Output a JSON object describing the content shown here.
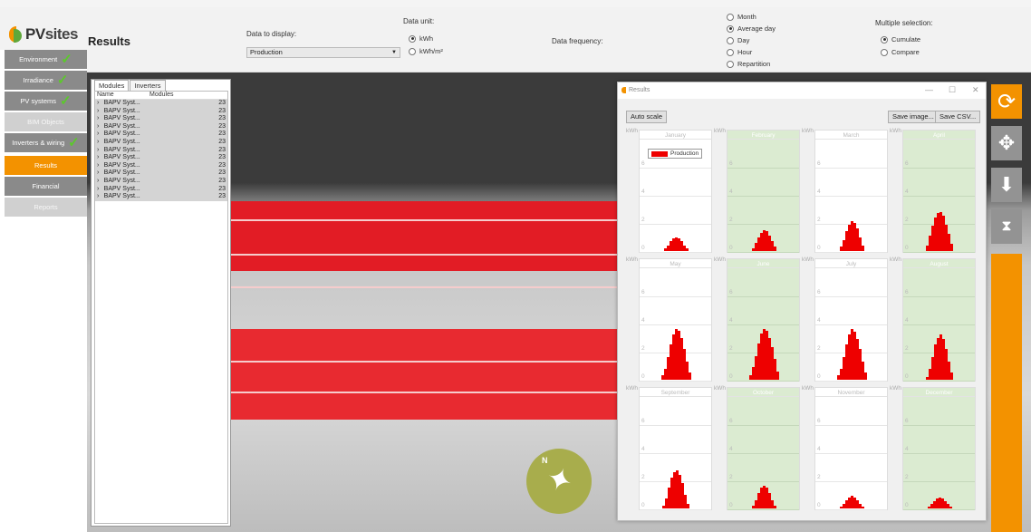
{
  "app": {
    "logo_text": "PVsites",
    "logo_pv": "PV",
    "logo_sites": "sites"
  },
  "page": {
    "title": "Results"
  },
  "controls": {
    "data_to_display_label": "Data to display:",
    "data_to_display_value": "Production",
    "data_unit_label": "Data unit:",
    "data_unit_options": [
      "kWh",
      "kWh/m²"
    ],
    "data_unit_selected": "kWh",
    "data_frequency_label": "Data frequency:",
    "data_frequency_options": [
      "Month",
      "Average day",
      "Day",
      "Hour",
      "Repartition"
    ],
    "data_frequency_selected": "Average day",
    "multiple_selection_label": "Multiple selection:",
    "multiple_selection_options": [
      "Cumulate",
      "Compare"
    ],
    "multiple_selection_selected": "Cumulate"
  },
  "sidebar": {
    "items": [
      {
        "label": "Environment",
        "state": "done"
      },
      {
        "label": "Irradiance",
        "state": "done"
      },
      {
        "label": "PV systems",
        "state": "done"
      },
      {
        "label": "BIM Objects",
        "state": "disabled"
      },
      {
        "label": "Inverters & wiring",
        "state": "done"
      },
      {
        "label": "Results",
        "state": "active"
      },
      {
        "label": "Financial",
        "state": "normal"
      },
      {
        "label": "Reports",
        "state": "disabled"
      }
    ]
  },
  "modules_panel": {
    "tabs": [
      "Modules",
      "Inverters"
    ],
    "columns": [
      "Name",
      "Modules"
    ],
    "rows": [
      {
        "name": "BAPV Syst...",
        "modules": "23"
      },
      {
        "name": "BAPV Syst...",
        "modules": "23"
      },
      {
        "name": "BAPV Syst...",
        "modules": "23"
      },
      {
        "name": "BAPV Syst...",
        "modules": "23"
      },
      {
        "name": "BAPV Syst...",
        "modules": "23"
      },
      {
        "name": "BAPV Syst...",
        "modules": "23"
      },
      {
        "name": "BAPV Syst...",
        "modules": "23"
      },
      {
        "name": "BAPV Syst...",
        "modules": "23"
      },
      {
        "name": "BAPV Syst...",
        "modules": "23"
      },
      {
        "name": "BAPV Syst...",
        "modules": "23"
      },
      {
        "name": "BAPV Syst...",
        "modules": "23"
      },
      {
        "name": "BAPV Syst...",
        "modules": "23"
      },
      {
        "name": "BAPV Syst...",
        "modules": "23"
      }
    ]
  },
  "results_window": {
    "title": "Results",
    "auto_scale_label": "Auto scale",
    "save_image_label": "Save image...",
    "save_csv_label": "Save CSV...",
    "unit": "kWh",
    "legend": "Production"
  },
  "viewport": {
    "compass_label": "N"
  },
  "colors": {
    "accent": "#f39200",
    "check": "#5cc82c",
    "production": "#ee0000",
    "alt_panel": "#dbebd1"
  },
  "chart_data": {
    "type": "bar",
    "ylabel": "kWh",
    "ylim": [
      0,
      8
    ],
    "yticks": [
      0,
      2,
      4,
      6
    ],
    "series_name": "Production",
    "months": [
      {
        "name": "January",
        "values": [
          0.2,
          0.4,
          0.7,
          0.9,
          1.0,
          0.9,
          0.7,
          0.4,
          0.2
        ]
      },
      {
        "name": "February",
        "values": [
          0.2,
          0.6,
          1.0,
          1.3,
          1.5,
          1.4,
          1.1,
          0.7,
          0.3
        ]
      },
      {
        "name": "March",
        "values": [
          0.3,
          0.8,
          1.4,
          1.9,
          2.1,
          2.0,
          1.6,
          1.0,
          0.4
        ]
      },
      {
        "name": "April",
        "values": [
          0.4,
          1.1,
          1.8,
          2.4,
          2.7,
          2.8,
          2.5,
          1.9,
          1.2,
          0.5
        ]
      },
      {
        "name": "May",
        "values": [
          0.3,
          0.8,
          1.6,
          2.5,
          3.2,
          3.6,
          3.5,
          3.0,
          2.2,
          1.3,
          0.5
        ]
      },
      {
        "name": "June",
        "values": [
          0.3,
          0.9,
          1.7,
          2.6,
          3.3,
          3.6,
          3.5,
          3.0,
          2.3,
          1.5,
          0.6
        ]
      },
      {
        "name": "July",
        "values": [
          0.3,
          0.8,
          1.6,
          2.5,
          3.2,
          3.6,
          3.4,
          2.9,
          2.2,
          1.3,
          0.5
        ]
      },
      {
        "name": "August",
        "values": [
          0.2,
          0.8,
          1.6,
          2.5,
          3.0,
          3.2,
          2.9,
          2.2,
          1.3,
          0.5
        ]
      },
      {
        "name": "September",
        "values": [
          0.2,
          0.7,
          1.5,
          2.2,
          2.6,
          2.7,
          2.4,
          1.8,
          1.0,
          0.3
        ]
      },
      {
        "name": "October",
        "values": [
          0.2,
          0.6,
          1.1,
          1.5,
          1.6,
          1.5,
          1.1,
          0.6,
          0.2
        ]
      },
      {
        "name": "November",
        "values": [
          0.1,
          0.3,
          0.6,
          0.8,
          0.9,
          0.8,
          0.6,
          0.3,
          0.1
        ]
      },
      {
        "name": "December",
        "values": [
          0.1,
          0.3,
          0.5,
          0.7,
          0.8,
          0.7,
          0.5,
          0.3,
          0.1
        ]
      }
    ]
  }
}
